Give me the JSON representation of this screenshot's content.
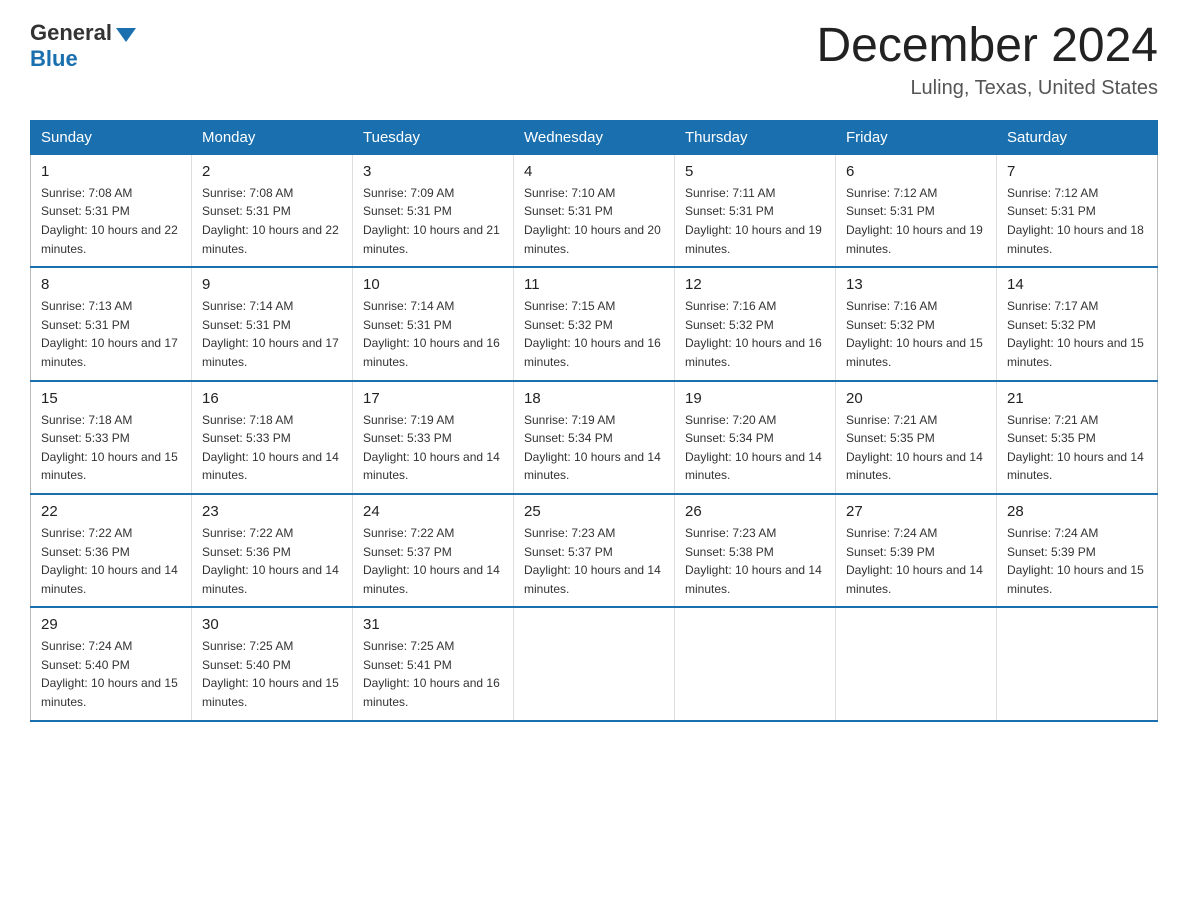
{
  "header": {
    "logo_general": "General",
    "logo_blue": "Blue",
    "month_title": "December 2024",
    "location": "Luling, Texas, United States"
  },
  "days_of_week": [
    "Sunday",
    "Monday",
    "Tuesday",
    "Wednesday",
    "Thursday",
    "Friday",
    "Saturday"
  ],
  "weeks": [
    [
      {
        "num": "1",
        "sunrise": "7:08 AM",
        "sunset": "5:31 PM",
        "daylight": "10 hours and 22 minutes."
      },
      {
        "num": "2",
        "sunrise": "7:08 AM",
        "sunset": "5:31 PM",
        "daylight": "10 hours and 22 minutes."
      },
      {
        "num": "3",
        "sunrise": "7:09 AM",
        "sunset": "5:31 PM",
        "daylight": "10 hours and 21 minutes."
      },
      {
        "num": "4",
        "sunrise": "7:10 AM",
        "sunset": "5:31 PM",
        "daylight": "10 hours and 20 minutes."
      },
      {
        "num": "5",
        "sunrise": "7:11 AM",
        "sunset": "5:31 PM",
        "daylight": "10 hours and 19 minutes."
      },
      {
        "num": "6",
        "sunrise": "7:12 AM",
        "sunset": "5:31 PM",
        "daylight": "10 hours and 19 minutes."
      },
      {
        "num": "7",
        "sunrise": "7:12 AM",
        "sunset": "5:31 PM",
        "daylight": "10 hours and 18 minutes."
      }
    ],
    [
      {
        "num": "8",
        "sunrise": "7:13 AM",
        "sunset": "5:31 PM",
        "daylight": "10 hours and 17 minutes."
      },
      {
        "num": "9",
        "sunrise": "7:14 AM",
        "sunset": "5:31 PM",
        "daylight": "10 hours and 17 minutes."
      },
      {
        "num": "10",
        "sunrise": "7:14 AM",
        "sunset": "5:31 PM",
        "daylight": "10 hours and 16 minutes."
      },
      {
        "num": "11",
        "sunrise": "7:15 AM",
        "sunset": "5:32 PM",
        "daylight": "10 hours and 16 minutes."
      },
      {
        "num": "12",
        "sunrise": "7:16 AM",
        "sunset": "5:32 PM",
        "daylight": "10 hours and 16 minutes."
      },
      {
        "num": "13",
        "sunrise": "7:16 AM",
        "sunset": "5:32 PM",
        "daylight": "10 hours and 15 minutes."
      },
      {
        "num": "14",
        "sunrise": "7:17 AM",
        "sunset": "5:32 PM",
        "daylight": "10 hours and 15 minutes."
      }
    ],
    [
      {
        "num": "15",
        "sunrise": "7:18 AM",
        "sunset": "5:33 PM",
        "daylight": "10 hours and 15 minutes."
      },
      {
        "num": "16",
        "sunrise": "7:18 AM",
        "sunset": "5:33 PM",
        "daylight": "10 hours and 14 minutes."
      },
      {
        "num": "17",
        "sunrise": "7:19 AM",
        "sunset": "5:33 PM",
        "daylight": "10 hours and 14 minutes."
      },
      {
        "num": "18",
        "sunrise": "7:19 AM",
        "sunset": "5:34 PM",
        "daylight": "10 hours and 14 minutes."
      },
      {
        "num": "19",
        "sunrise": "7:20 AM",
        "sunset": "5:34 PM",
        "daylight": "10 hours and 14 minutes."
      },
      {
        "num": "20",
        "sunrise": "7:21 AM",
        "sunset": "5:35 PM",
        "daylight": "10 hours and 14 minutes."
      },
      {
        "num": "21",
        "sunrise": "7:21 AM",
        "sunset": "5:35 PM",
        "daylight": "10 hours and 14 minutes."
      }
    ],
    [
      {
        "num": "22",
        "sunrise": "7:22 AM",
        "sunset": "5:36 PM",
        "daylight": "10 hours and 14 minutes."
      },
      {
        "num": "23",
        "sunrise": "7:22 AM",
        "sunset": "5:36 PM",
        "daylight": "10 hours and 14 minutes."
      },
      {
        "num": "24",
        "sunrise": "7:22 AM",
        "sunset": "5:37 PM",
        "daylight": "10 hours and 14 minutes."
      },
      {
        "num": "25",
        "sunrise": "7:23 AM",
        "sunset": "5:37 PM",
        "daylight": "10 hours and 14 minutes."
      },
      {
        "num": "26",
        "sunrise": "7:23 AM",
        "sunset": "5:38 PM",
        "daylight": "10 hours and 14 minutes."
      },
      {
        "num": "27",
        "sunrise": "7:24 AM",
        "sunset": "5:39 PM",
        "daylight": "10 hours and 14 minutes."
      },
      {
        "num": "28",
        "sunrise": "7:24 AM",
        "sunset": "5:39 PM",
        "daylight": "10 hours and 15 minutes."
      }
    ],
    [
      {
        "num": "29",
        "sunrise": "7:24 AM",
        "sunset": "5:40 PM",
        "daylight": "10 hours and 15 minutes."
      },
      {
        "num": "30",
        "sunrise": "7:25 AM",
        "sunset": "5:40 PM",
        "daylight": "10 hours and 15 minutes."
      },
      {
        "num": "31",
        "sunrise": "7:25 AM",
        "sunset": "5:41 PM",
        "daylight": "10 hours and 16 minutes."
      },
      null,
      null,
      null,
      null
    ]
  ]
}
